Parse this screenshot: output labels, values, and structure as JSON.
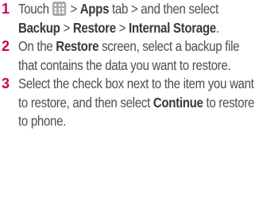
{
  "steps": [
    {
      "num": "1",
      "parts": {
        "touch": "Touch",
        "gt1": ">",
        "apps": "Apps",
        "tab_and_then": "tab > and then select",
        "backup": "Backup",
        "gt2": ">",
        "restore": "Restore",
        "gt3": ">",
        "internal": "Internal",
        "storage": "Storage",
        "period": "."
      },
      "icon": "apps-grid-icon"
    },
    {
      "num": "2",
      "parts": {
        "on_the": "On the",
        "restore": "Restore",
        "rest": "screen, select a backup file that contains the data you want to restore."
      }
    },
    {
      "num": "3",
      "parts": {
        "lead": "Select the check box next to the item you want to restore, and then select",
        "continue": "Continue",
        "tail": "to restore to phone."
      }
    }
  ]
}
